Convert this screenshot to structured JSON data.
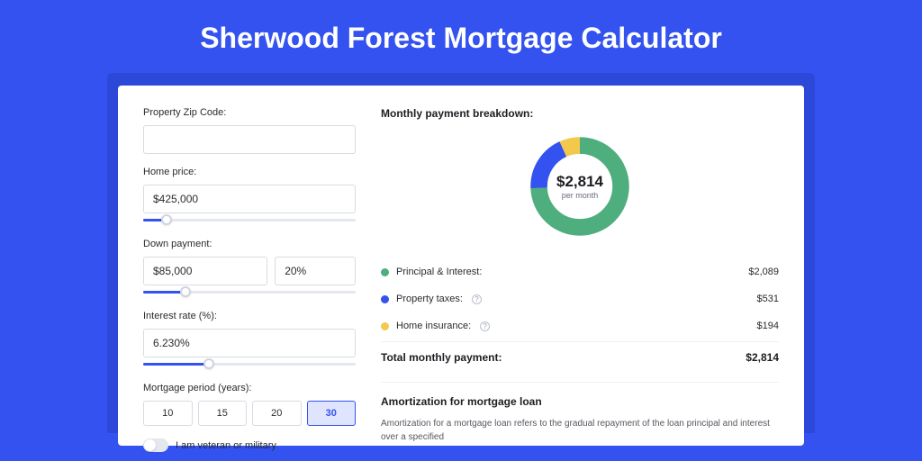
{
  "title": "Sherwood Forest Mortgage Calculator",
  "colors": {
    "accent": "#3352ef",
    "green": "#4fae7d",
    "blue": "#3352ef",
    "yellow": "#f2c94c"
  },
  "form": {
    "zip": {
      "label": "Property Zip Code:",
      "value": "",
      "placeholder": ""
    },
    "home_price": {
      "label": "Home price:",
      "value": "$425,000",
      "slider_pct": 11
    },
    "down_payment": {
      "label": "Down payment:",
      "amount": "$85,000",
      "pct": "20%",
      "slider_pct": 20
    },
    "interest": {
      "label": "Interest rate (%):",
      "value": "6.230%",
      "slider_pct": 31
    },
    "period": {
      "label": "Mortgage period (years):",
      "options": [
        "10",
        "15",
        "20",
        "30"
      ],
      "selected": "30"
    },
    "veteran": {
      "label": "I am veteran or military",
      "checked": false
    }
  },
  "breakdown": {
    "title": "Monthly payment breakdown:",
    "total_amount": "$2,814",
    "total_sub": "per month",
    "items": [
      {
        "label": "Principal & Interest:",
        "value": "$2,089",
        "color": "#4fae7d",
        "info": false
      },
      {
        "label": "Property taxes:",
        "value": "$531",
        "color": "#3352ef",
        "info": true
      },
      {
        "label": "Home insurance:",
        "value": "$194",
        "color": "#f2c94c",
        "info": true
      }
    ],
    "total_label": "Total monthly payment:",
    "total_value": "$2,814"
  },
  "amortization": {
    "title": "Amortization for mortgage loan",
    "text": "Amortization for a mortgage loan refers to the gradual repayment of the loan principal and interest over a specified"
  },
  "chart_data": {
    "type": "pie",
    "title": "Monthly payment breakdown",
    "series": [
      {
        "name": "Principal & Interest",
        "value": 2089,
        "color": "#4fae7d"
      },
      {
        "name": "Property taxes",
        "value": 531,
        "color": "#3352ef"
      },
      {
        "name": "Home insurance",
        "value": 194,
        "color": "#f2c94c"
      }
    ],
    "total": 2814,
    "unit": "USD per month"
  }
}
